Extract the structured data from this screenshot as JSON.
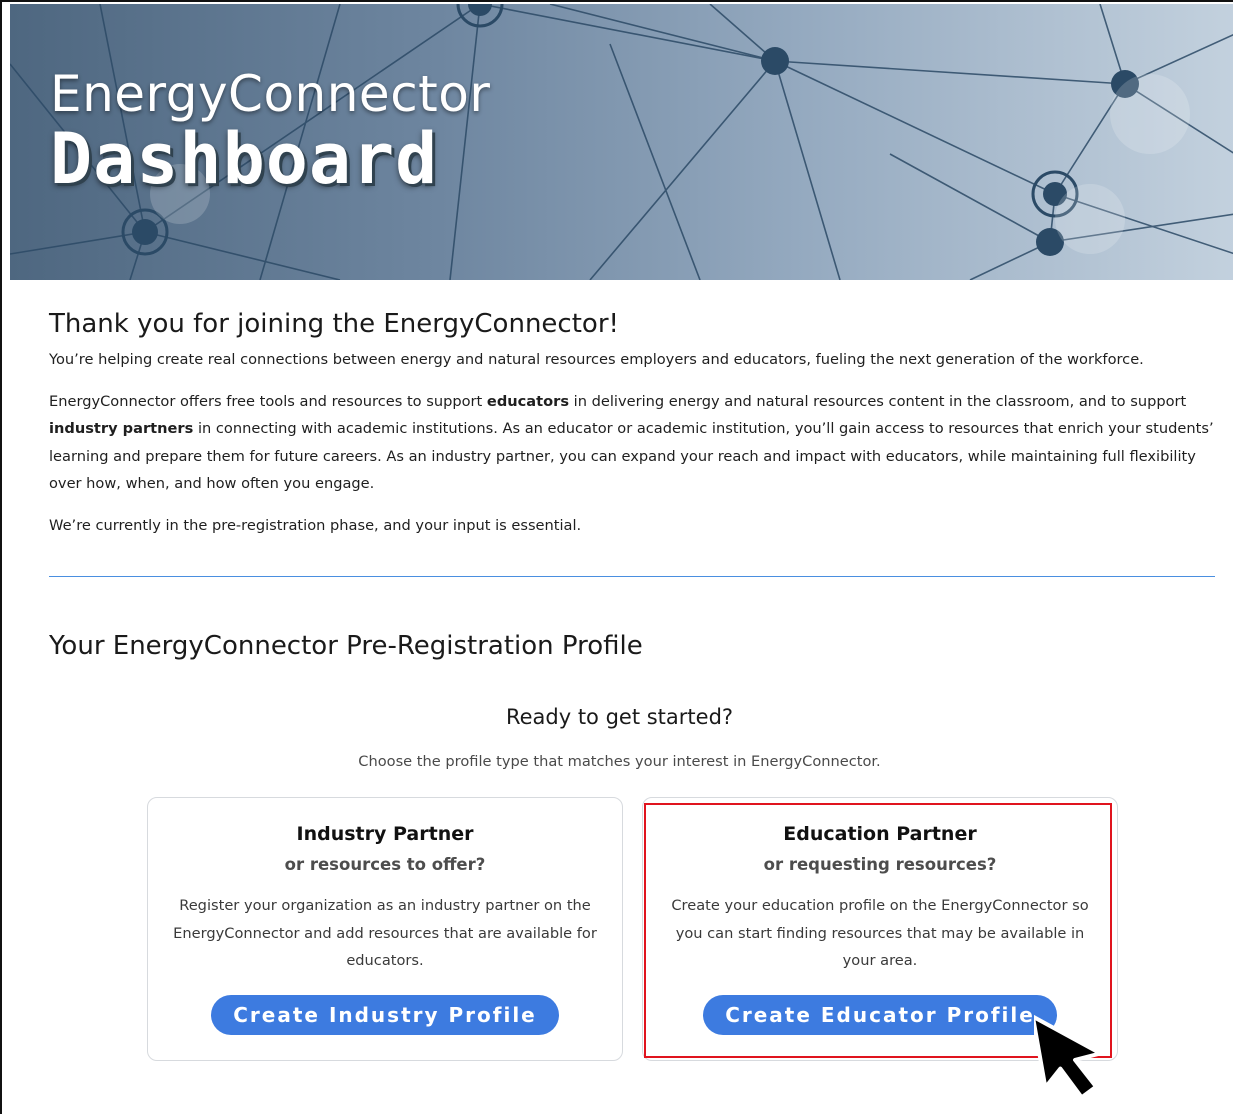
{
  "hero": {
    "line1": "EnergyConnector",
    "line2": "Dashboard"
  },
  "intro": {
    "heading": "Thank you for joining the EnergyConnector!",
    "p1": "You’re helping create real connections between energy and natural resources employers and educators, fueling the next generation of the workforce.",
    "p2_part1": "EnergyConnector offers free tools and resources to support ",
    "p2_bold1": "educators",
    "p2_part2": " in delivering energy and natural resources content in the classroom, and to support ",
    "p2_bold2": "industry partners",
    "p2_part3": " in connecting with academic institutions. As an educator or academic institution, you’ll gain access to resources that enrich your students’ learning and prepare them for future careers. As an industry partner, you can expand your reach and impact with educators, while maintaining full flexibility over how, when, and how often you engage.",
    "p3": "We’re currently in the pre-registration phase, and your input is essential."
  },
  "profile": {
    "heading": "Your EnergyConnector Pre-Registration Profile",
    "ready": "Ready to get started?",
    "choose": "Choose the profile type that matches your interest in EnergyConnector."
  },
  "cards": {
    "industry": {
      "title": "Industry Partner",
      "subtitle": "or resources to offer?",
      "description": "Register your organization as an industry partner on the EnergyConnector and add resources that are available for educators.",
      "button": "Create Industry Profile"
    },
    "education": {
      "title": "Education Partner",
      "subtitle": "or requesting resources?",
      "description": "Create your education profile on the EnergyConnector so you can start finding resources that may be available in your area.",
      "button": "Create Educator Profile"
    }
  },
  "colors": {
    "accent": "#3d7be0",
    "highlight": "#e0141e",
    "divider": "#4a8fe0"
  }
}
